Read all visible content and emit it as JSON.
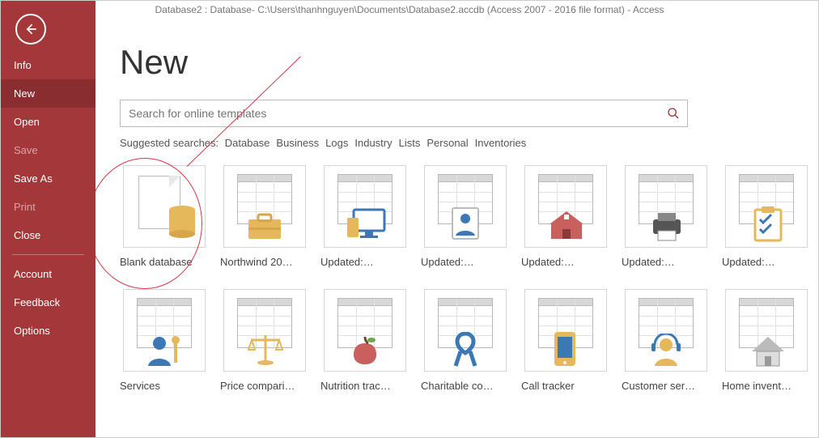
{
  "window_title": "Database2 : Database- C:\\Users\\thanhnguyen\\Documents\\Database2.accdb (Access 2007 - 2016 file format)  -  Access",
  "sidebar": {
    "items": [
      {
        "label": "Info",
        "selected": false,
        "disabled": false
      },
      {
        "label": "New",
        "selected": true,
        "disabled": false
      },
      {
        "label": "Open",
        "selected": false,
        "disabled": false
      },
      {
        "label": "Save",
        "selected": false,
        "disabled": true
      },
      {
        "label": "Save As",
        "selected": false,
        "disabled": false
      },
      {
        "label": "Print",
        "selected": false,
        "disabled": true
      },
      {
        "label": "Close",
        "selected": false,
        "disabled": false
      },
      {
        "label": "Account",
        "selected": false,
        "disabled": false
      },
      {
        "label": "Feedback",
        "selected": false,
        "disabled": false
      },
      {
        "label": "Options",
        "selected": false,
        "disabled": false
      }
    ]
  },
  "page": {
    "title": "New"
  },
  "search": {
    "placeholder": "Search for online templates"
  },
  "suggest": {
    "label": "Suggested searches:",
    "items": [
      "Database",
      "Business",
      "Logs",
      "Industry",
      "Lists",
      "Personal",
      "Inventories"
    ]
  },
  "templates": [
    {
      "label": "Blank database",
      "icon": "blank-db"
    },
    {
      "label": "Northwind 20…",
      "icon": "briefcase"
    },
    {
      "label": "Updated:…",
      "icon": "devices"
    },
    {
      "label": "Updated:…",
      "icon": "contact"
    },
    {
      "label": "Updated:…",
      "icon": "school"
    },
    {
      "label": "Updated:…",
      "icon": "printer"
    },
    {
      "label": "Updated:…",
      "icon": "checklist"
    },
    {
      "label": "Services",
      "icon": "person-wrench"
    },
    {
      "label": "Price compari…",
      "icon": "scales"
    },
    {
      "label": "Nutrition trac…",
      "icon": "apple"
    },
    {
      "label": "Charitable co…",
      "icon": "ribbon"
    },
    {
      "label": "Call tracker",
      "icon": "phone"
    },
    {
      "label": "Customer ser…",
      "icon": "headset"
    },
    {
      "label": "Home invent…",
      "icon": "house"
    }
  ]
}
